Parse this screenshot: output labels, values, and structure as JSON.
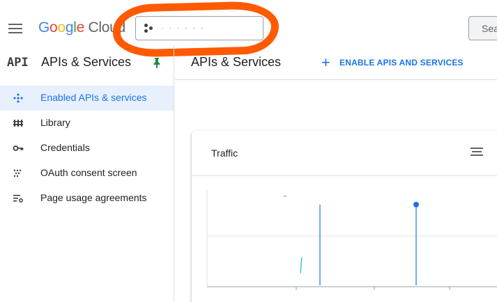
{
  "header": {
    "logo_google": [
      "G",
      "o",
      "o",
      "g",
      "l",
      "e"
    ],
    "logo_cloud": "Cloud",
    "project_name": "· ·          · · · ·",
    "search_placeholder": "Sea"
  },
  "sidebar": {
    "logo": "API",
    "title": "APIs & Services",
    "items": [
      {
        "label": "Enabled APIs & services",
        "icon": "diamond-dots-icon",
        "active": true
      },
      {
        "label": "Library",
        "icon": "library-icon",
        "active": false
      },
      {
        "label": "Credentials",
        "icon": "key-icon",
        "active": false
      },
      {
        "label": "OAuth consent screen",
        "icon": "consent-dots-icon",
        "active": false
      },
      {
        "label": "Page usage agreements",
        "icon": "settings-list-icon",
        "active": false
      }
    ]
  },
  "content": {
    "title": "APIs & Services",
    "enable_button_label": "ENABLE APIS AND SERVICES"
  },
  "card": {
    "title": "Traffic"
  },
  "colors": {
    "accent": "#1a73e8",
    "annotation": "#ff5a00",
    "active_bg": "#e8f0fe"
  },
  "chart_data": {
    "type": "line",
    "title": "Traffic",
    "series": [
      {
        "values": [
          0.15,
          0.35
        ]
      },
      {
        "values": [
          0.0,
          1.0
        ]
      },
      {
        "values": [
          0.0,
          1.0
        ]
      }
    ],
    "note_markers": [
      {
        "series": 2,
        "point": "top"
      }
    ],
    "grid": true
  }
}
